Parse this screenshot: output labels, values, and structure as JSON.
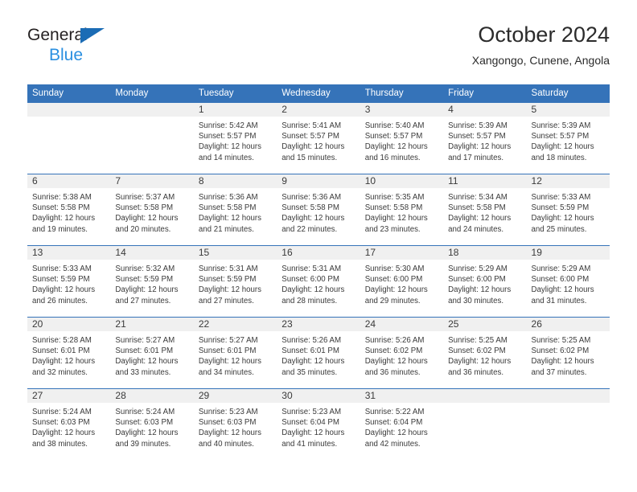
{
  "brand": {
    "line1": "General",
    "line2": "Blue",
    "triangle_color": "#1b6cb5",
    "line2_color": "#2a8fe0"
  },
  "header": {
    "title": "October 2024",
    "subtitle": "Xangongo, Cunene, Angola"
  },
  "theme": {
    "header_blue": "#3573b9",
    "numband_gray": "#f0f0f0",
    "text": "#3a3a3a"
  },
  "weekday_headers": [
    "Sunday",
    "Monday",
    "Tuesday",
    "Wednesday",
    "Thursday",
    "Friday",
    "Saturday"
  ],
  "weeks": [
    [
      {
        "day": "",
        "sunrise": "",
        "sunset": "",
        "daylight_1": "",
        "daylight_2": ""
      },
      {
        "day": "",
        "sunrise": "",
        "sunset": "",
        "daylight_1": "",
        "daylight_2": ""
      },
      {
        "day": "1",
        "sunrise": "Sunrise: 5:42 AM",
        "sunset": "Sunset: 5:57 PM",
        "daylight_1": "Daylight: 12 hours",
        "daylight_2": "and 14 minutes."
      },
      {
        "day": "2",
        "sunrise": "Sunrise: 5:41 AM",
        "sunset": "Sunset: 5:57 PM",
        "daylight_1": "Daylight: 12 hours",
        "daylight_2": "and 15 minutes."
      },
      {
        "day": "3",
        "sunrise": "Sunrise: 5:40 AM",
        "sunset": "Sunset: 5:57 PM",
        "daylight_1": "Daylight: 12 hours",
        "daylight_2": "and 16 minutes."
      },
      {
        "day": "4",
        "sunrise": "Sunrise: 5:39 AM",
        "sunset": "Sunset: 5:57 PM",
        "daylight_1": "Daylight: 12 hours",
        "daylight_2": "and 17 minutes."
      },
      {
        "day": "5",
        "sunrise": "Sunrise: 5:39 AM",
        "sunset": "Sunset: 5:57 PM",
        "daylight_1": "Daylight: 12 hours",
        "daylight_2": "and 18 minutes."
      }
    ],
    [
      {
        "day": "6",
        "sunrise": "Sunrise: 5:38 AM",
        "sunset": "Sunset: 5:58 PM",
        "daylight_1": "Daylight: 12 hours",
        "daylight_2": "and 19 minutes."
      },
      {
        "day": "7",
        "sunrise": "Sunrise: 5:37 AM",
        "sunset": "Sunset: 5:58 PM",
        "daylight_1": "Daylight: 12 hours",
        "daylight_2": "and 20 minutes."
      },
      {
        "day": "8",
        "sunrise": "Sunrise: 5:36 AM",
        "sunset": "Sunset: 5:58 PM",
        "daylight_1": "Daylight: 12 hours",
        "daylight_2": "and 21 minutes."
      },
      {
        "day": "9",
        "sunrise": "Sunrise: 5:36 AM",
        "sunset": "Sunset: 5:58 PM",
        "daylight_1": "Daylight: 12 hours",
        "daylight_2": "and 22 minutes."
      },
      {
        "day": "10",
        "sunrise": "Sunrise: 5:35 AM",
        "sunset": "Sunset: 5:58 PM",
        "daylight_1": "Daylight: 12 hours",
        "daylight_2": "and 23 minutes."
      },
      {
        "day": "11",
        "sunrise": "Sunrise: 5:34 AM",
        "sunset": "Sunset: 5:58 PM",
        "daylight_1": "Daylight: 12 hours",
        "daylight_2": "and 24 minutes."
      },
      {
        "day": "12",
        "sunrise": "Sunrise: 5:33 AM",
        "sunset": "Sunset: 5:59 PM",
        "daylight_1": "Daylight: 12 hours",
        "daylight_2": "and 25 minutes."
      }
    ],
    [
      {
        "day": "13",
        "sunrise": "Sunrise: 5:33 AM",
        "sunset": "Sunset: 5:59 PM",
        "daylight_1": "Daylight: 12 hours",
        "daylight_2": "and 26 minutes."
      },
      {
        "day": "14",
        "sunrise": "Sunrise: 5:32 AM",
        "sunset": "Sunset: 5:59 PM",
        "daylight_1": "Daylight: 12 hours",
        "daylight_2": "and 27 minutes."
      },
      {
        "day": "15",
        "sunrise": "Sunrise: 5:31 AM",
        "sunset": "Sunset: 5:59 PM",
        "daylight_1": "Daylight: 12 hours",
        "daylight_2": "and 27 minutes."
      },
      {
        "day": "16",
        "sunrise": "Sunrise: 5:31 AM",
        "sunset": "Sunset: 6:00 PM",
        "daylight_1": "Daylight: 12 hours",
        "daylight_2": "and 28 minutes."
      },
      {
        "day": "17",
        "sunrise": "Sunrise: 5:30 AM",
        "sunset": "Sunset: 6:00 PM",
        "daylight_1": "Daylight: 12 hours",
        "daylight_2": "and 29 minutes."
      },
      {
        "day": "18",
        "sunrise": "Sunrise: 5:29 AM",
        "sunset": "Sunset: 6:00 PM",
        "daylight_1": "Daylight: 12 hours",
        "daylight_2": "and 30 minutes."
      },
      {
        "day": "19",
        "sunrise": "Sunrise: 5:29 AM",
        "sunset": "Sunset: 6:00 PM",
        "daylight_1": "Daylight: 12 hours",
        "daylight_2": "and 31 minutes."
      }
    ],
    [
      {
        "day": "20",
        "sunrise": "Sunrise: 5:28 AM",
        "sunset": "Sunset: 6:01 PM",
        "daylight_1": "Daylight: 12 hours",
        "daylight_2": "and 32 minutes."
      },
      {
        "day": "21",
        "sunrise": "Sunrise: 5:27 AM",
        "sunset": "Sunset: 6:01 PM",
        "daylight_1": "Daylight: 12 hours",
        "daylight_2": "and 33 minutes."
      },
      {
        "day": "22",
        "sunrise": "Sunrise: 5:27 AM",
        "sunset": "Sunset: 6:01 PM",
        "daylight_1": "Daylight: 12 hours",
        "daylight_2": "and 34 minutes."
      },
      {
        "day": "23",
        "sunrise": "Sunrise: 5:26 AM",
        "sunset": "Sunset: 6:01 PM",
        "daylight_1": "Daylight: 12 hours",
        "daylight_2": "and 35 minutes."
      },
      {
        "day": "24",
        "sunrise": "Sunrise: 5:26 AM",
        "sunset": "Sunset: 6:02 PM",
        "daylight_1": "Daylight: 12 hours",
        "daylight_2": "and 36 minutes."
      },
      {
        "day": "25",
        "sunrise": "Sunrise: 5:25 AM",
        "sunset": "Sunset: 6:02 PM",
        "daylight_1": "Daylight: 12 hours",
        "daylight_2": "and 36 minutes."
      },
      {
        "day": "26",
        "sunrise": "Sunrise: 5:25 AM",
        "sunset": "Sunset: 6:02 PM",
        "daylight_1": "Daylight: 12 hours",
        "daylight_2": "and 37 minutes."
      }
    ],
    [
      {
        "day": "27",
        "sunrise": "Sunrise: 5:24 AM",
        "sunset": "Sunset: 6:03 PM",
        "daylight_1": "Daylight: 12 hours",
        "daylight_2": "and 38 minutes."
      },
      {
        "day": "28",
        "sunrise": "Sunrise: 5:24 AM",
        "sunset": "Sunset: 6:03 PM",
        "daylight_1": "Daylight: 12 hours",
        "daylight_2": "and 39 minutes."
      },
      {
        "day": "29",
        "sunrise": "Sunrise: 5:23 AM",
        "sunset": "Sunset: 6:03 PM",
        "daylight_1": "Daylight: 12 hours",
        "daylight_2": "and 40 minutes."
      },
      {
        "day": "30",
        "sunrise": "Sunrise: 5:23 AM",
        "sunset": "Sunset: 6:04 PM",
        "daylight_1": "Daylight: 12 hours",
        "daylight_2": "and 41 minutes."
      },
      {
        "day": "31",
        "sunrise": "Sunrise: 5:22 AM",
        "sunset": "Sunset: 6:04 PM",
        "daylight_1": "Daylight: 12 hours",
        "daylight_2": "and 42 minutes."
      },
      {
        "day": "",
        "sunrise": "",
        "sunset": "",
        "daylight_1": "",
        "daylight_2": ""
      },
      {
        "day": "",
        "sunrise": "",
        "sunset": "",
        "daylight_1": "",
        "daylight_2": ""
      }
    ]
  ]
}
